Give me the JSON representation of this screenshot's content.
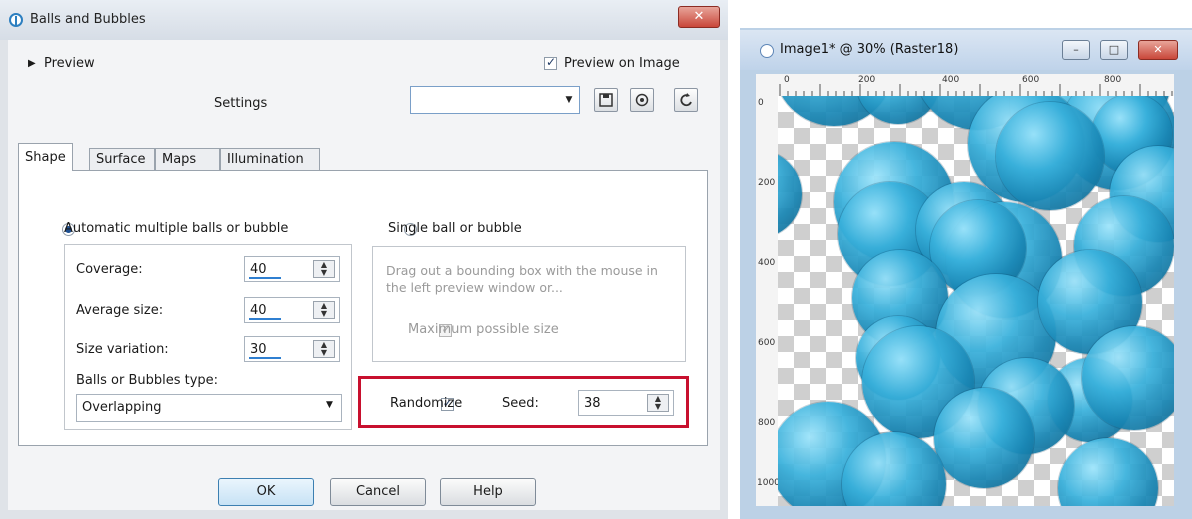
{
  "dialog": {
    "title": "Balls and Bubbles",
    "close_label": "✕",
    "preview_label": "Preview",
    "preview_on_image_label": "Preview on Image",
    "preview_on_image_checked": true,
    "settings_label": "Settings",
    "settings_value": "",
    "tabs": [
      {
        "label": "Shape",
        "active": true
      },
      {
        "label": "Surface",
        "active": false
      },
      {
        "label": "Maps",
        "active": false
      },
      {
        "label": "Illumination",
        "active": false
      }
    ],
    "auto_option_label": "Automatic multiple balls or bubble",
    "auto_option_selected": true,
    "single_option_label": "Single ball or bubble",
    "coverage": {
      "label": "Coverage:",
      "value": "40"
    },
    "average_size": {
      "label": "Average size:",
      "value": "40"
    },
    "size_variation": {
      "label": "Size variation:",
      "value": "30"
    },
    "type": {
      "label": "Balls or Bubbles type:",
      "value": "Overlapping"
    },
    "single_hint": "Drag out a bounding box with the mouse in the left preview window or...",
    "max_size_label": "Maximum possible size",
    "randomize_label": "Randomize",
    "randomize_checked": true,
    "seed_label": "Seed:",
    "seed_value": "38",
    "buttons": {
      "ok": "OK",
      "cancel": "Cancel",
      "help": "Help"
    }
  },
  "image_window": {
    "title": "Image1* @ 30% (Raster18)",
    "min_label": "–",
    "max_label": "□",
    "close_label": "✕",
    "ruler_top_labels": [
      "0",
      "200",
      "400",
      "600",
      "800"
    ],
    "ruler_left_labels": [
      "0",
      "200",
      "400",
      "600",
      "800",
      "1000"
    ]
  },
  "colors": {
    "highlight": "#c8102e",
    "ball": "#2aa2d1",
    "ok_button": "#c7e2f5"
  },
  "icons": {
    "app": "balls-app-icon",
    "save": "save-preset-icon",
    "import": "import-preset-icon",
    "reset": "reset-icon"
  }
}
